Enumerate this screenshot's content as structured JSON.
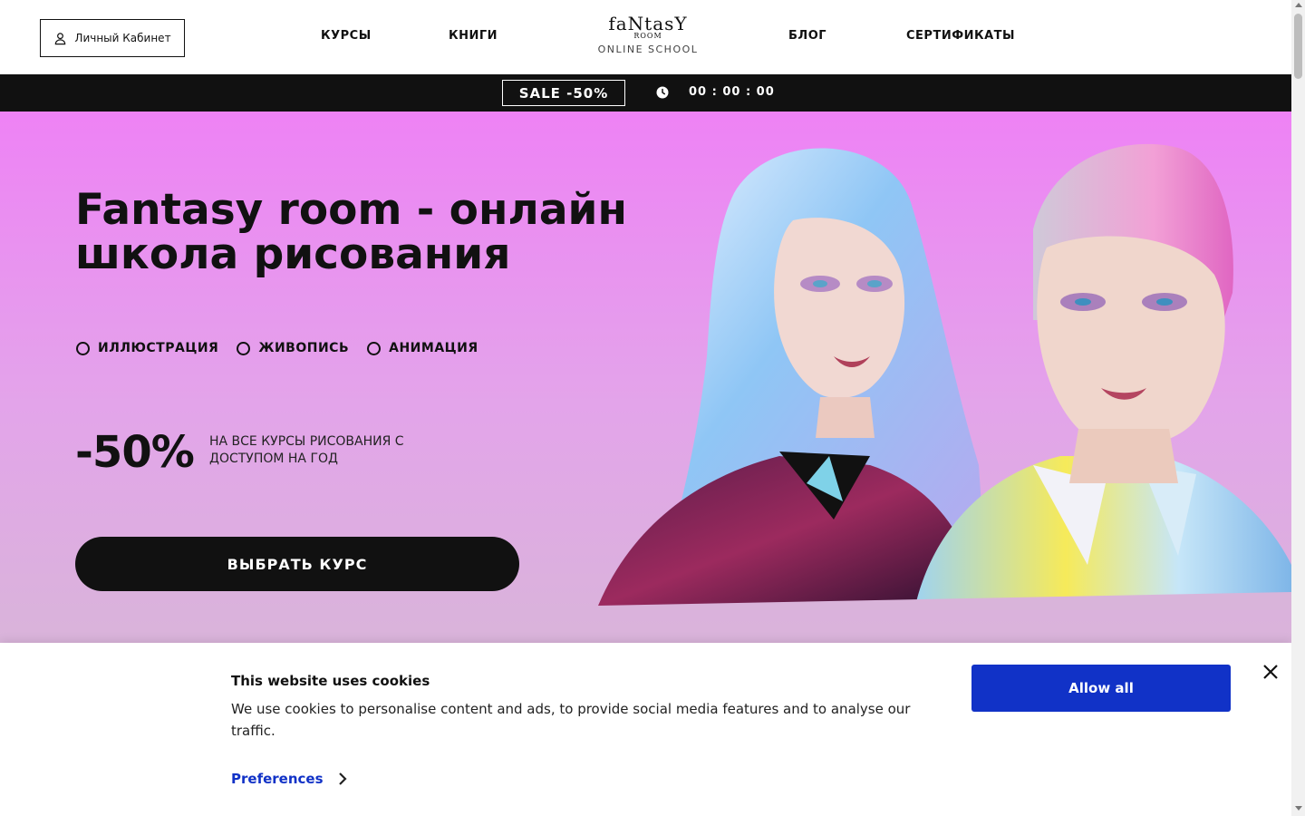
{
  "header": {
    "account_label": "Личный Кабинет",
    "nav": [
      "КУРСЫ",
      "КНИГИ",
      "БЛОГ",
      "СЕРТИФИКАТЫ"
    ],
    "logo": {
      "title": "faNtasY",
      "sub": "ROOM",
      "school": "ONLINE SCHOOL"
    }
  },
  "salebar": {
    "sale_label": "SALE  -50%",
    "timer": "00 : 00 : 00"
  },
  "hero": {
    "title": "Fantasy room - онлайн школа рисования",
    "tags": [
      "ИЛЛЮСТРАЦИЯ",
      "ЖИВОПИСЬ",
      "АНИМАЦИЯ"
    ],
    "discount": "-50%",
    "discount_text": "НА ВСЕ КУРСЫ РИСОВАНИЯ С ДОСТУПОМ НА ГОД",
    "cta": "ВЫБРАТЬ КУРС"
  },
  "cookie": {
    "title": "This website uses cookies",
    "text": "We use cookies to personalise content and ads, to provide social media features and to analyse our traffic.",
    "preferences": "Preferences",
    "allow_all": "Allow all"
  },
  "colors": {
    "hero_top": "#ee82f5",
    "accent_blue": "#1132c7",
    "dark": "#111111"
  }
}
